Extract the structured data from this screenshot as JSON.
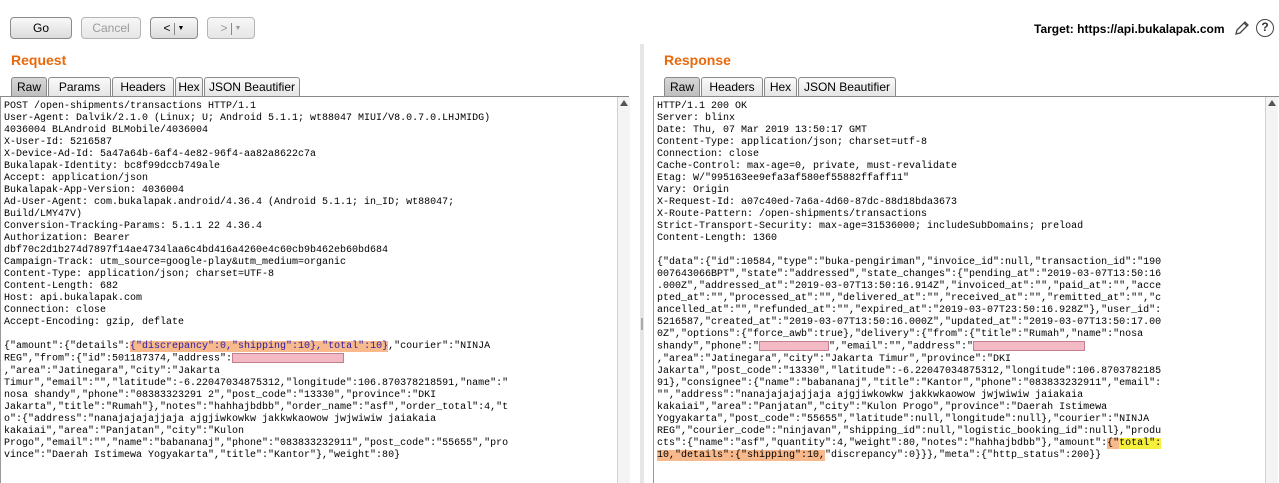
{
  "toolbar": {
    "go_label": "Go",
    "cancel_label": "Cancel",
    "back_label": "<",
    "forward_label": ">",
    "target_label": "Target:",
    "target_url": "https://api.bukalapak.com"
  },
  "request": {
    "title": "Request",
    "tabs": [
      "Raw",
      "Params",
      "Headers",
      "Hex",
      "JSON Beautifier"
    ],
    "active_tab": "Raw",
    "headers": [
      "POST /open-shipments/transactions HTTP/1.1",
      "User-Agent: Dalvik/2.1.0 (Linux; U; Android 5.1.1; wt88047 MIUI/V8.0.7.0.LHJMIDG)",
      "4036004 BLAndroid BLMobile/4036004",
      "X-User-Id: 5216587",
      "X-Device-Ad-Id: 5a47a64b-6af4-4e82-96f4-aa82a8622c7a",
      "Bukalapak-Identity: bc8f99dccb749ale",
      "Accept: application/json",
      "Bukalapak-App-Version: 4036004",
      "Ad-User-Agent: com.bukalapak.android/4.36.4 (Android 5.1.1; in_ID; wt88047;",
      "Build/LMY47V)",
      "Conversion-Tracking-Params: 5.1.1 22 4.36.4",
      "Authorization: Bearer",
      "dbf70c2d1b274d7897f14ae4734laa6c4bd416a4260e4c60cb9b462eb60bd684",
      "Campaign-Track: utm_source=google-play&utm_medium=organic",
      "Content-Type: application/json; charset=UTF-8",
      "Content-Length: 682",
      "Host: api.bukalapak.com",
      "Connection: close",
      "Accept-Encoding: gzip, deflate"
    ],
    "body": {
      "l1_pre": "{\"amount\":{\"details\":",
      "l1_hl": "{\"discrepancy\":0,\"shipping\":10},\"total\":10}",
      "l1_post": ",\"courier\":\"NINJA",
      "l2_pre": "REG\",\"from\":{\"id\":501187374,\"address\":",
      "l3": ",\"area\":\"Jatinegara\",\"city\":\"Jakarta",
      "l4": "Timur\",\"email\":\"\",\"latitude\":-6.22047034875312,\"longitude\":106.870378218591,\"name\":\"",
      "l5": "nosa shandy\",\"phone\":\"08383323291 2\",\"post_code\":\"13330\",\"province\":\"DKI",
      "l6": "Jakarta\",\"title\":\"Rumah\"},\"notes\":\"hahhajbdbb\",\"order_name\":\"asf\",\"order_total\":4,\"t",
      "l7": "o\":{\"address\":\"nanajajajajjaja ajgjiwkowkw jakkwkaowow jwjwiwiw jaiakaia",
      "l8": "kakaiai\",\"area\":\"Panjatan\",\"city\":\"Kulon",
      "l9": "Progo\",\"email\":\"\",\"name\":\"babananaj\",\"phone\":\"083833232911\",\"post_code\":\"55655\",\"pro",
      "l10": "vince\":\"Daerah Istimewa Yogyakarta\",\"title\":\"Kantor\"},\"weight\":80}"
    }
  },
  "response": {
    "title": "Response",
    "tabs": [
      "Raw",
      "Headers",
      "Hex",
      "JSON Beautifier"
    ],
    "active_tab": "Raw",
    "headers": [
      "HTTP/1.1 200 OK",
      "Server: blinx",
      "Date: Thu, 07 Mar 2019 13:50:17 GMT",
      "Content-Type: application/json; charset=utf-8",
      "Connection: close",
      "Cache-Control: max-age=0, private, must-revalidate",
      "Etag: W/\"995163ee9efa3af580ef55882ffaff11\"",
      "Vary: Origin",
      "X-Request-Id: a07c40ed-7a6a-4d60-87dc-88d18bda3673",
      "X-Route-Pattern: /open-shipments/transactions",
      "Strict-Transport-Security: max-age=31536000; includeSubDomains; preload",
      "Content-Length: 1360"
    ],
    "body": {
      "l1": "{\"data\":{\"id\":10584,\"type\":\"buka-pengiriman\",\"invoice_id\":null,\"transaction_id\":\"190",
      "l2": "007643066BPT\",\"state\":\"addressed\",\"state_changes\":{\"pending_at\":\"2019-03-07T13:50:16",
      "l3": ".000Z\",\"addressed_at\":\"2019-03-07T13:50:16.914Z\",\"invoiced_at\":\"\",\"paid_at\":\"\",\"acce",
      "l4": "pted_at\":\"\",\"processed_at\":\"\",\"delivered_at\":\"\",\"received_at\":\"\",\"remitted_at\":\"\",\"c",
      "l5": "ancelled_at\":\"\",\"refunded_at\":\"\",\"expired_at\":\"2019-03-07T23:50:16.928Z\"},\"user_id\":",
      "l6": "5216587,\"created_at\":\"2019-03-07T13:50:16.000Z\",\"updated_at\":\"2019-03-07T13:50:17.00",
      "l7": "0Z\",\"options\":{\"force_awb\":true},\"delivery\":{\"from\":{\"title\":\"Rumah\",\"name\":\"nosa",
      "l8_pre": "shandy\",\"phone\":\"",
      "l8_mid": "\",\"email\":\"\",\"address\":\"",
      "l9": ",\"area\":\"Jatinegara\",\"city\":\"Jakarta Timur\",\"province\":\"DKI",
      "l10": "Jakarta\",\"post_code\":\"13330\",\"latitude\":-6.22047034875312,\"longitude\":106.8703782185",
      "l11": "91},\"consignee\":{\"name\":\"babananaj\",\"title\":\"Kantor\",\"phone\":\"083833232911\",\"email\":",
      "l12": "\"\",\"address\":\"nanajajajajjaja ajgjiwkowkw jakkwkaowow jwjwiwiw jaiakaia",
      "l13": "kakaiai\",\"area\":\"Panjatan\",\"city\":\"Kulon Progo\",\"province\":\"Daerah Istimewa",
      "l14": "Yogyakarta\",\"post_code\":\"55655\",\"latitude\":null,\"longitude\":null},\"courier\":\"NINJA",
      "l15": "REG\",\"courier_code\":\"ninjavan\",\"shipping_id\":null,\"logistic_booking_id\":null},\"produ",
      "l16_pre": "cts\":{\"name\":\"asf\",\"quantity\":4,\"weight\":80,\"notes\":\"hahhajbdbb\"},\"amount\":",
      "l16_hl_a": "{\"",
      "l16_hl_b": "total\":",
      "l17_hl": "10,\"details\":{\"shipping\":10,",
      "l17_post": "\"discrepancy\":0}}},\"meta\":{\"http_status\":200}}"
    }
  }
}
